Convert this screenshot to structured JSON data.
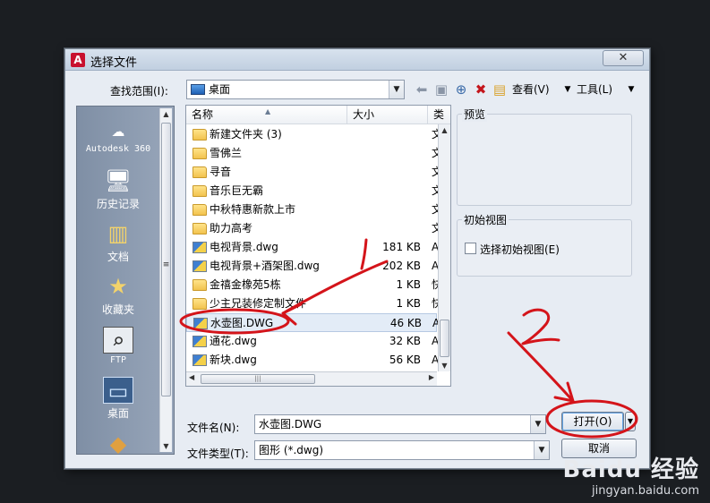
{
  "dialog": {
    "title": "选择文件",
    "app_icon_glyph": "A",
    "close_glyph": "✕"
  },
  "lookin": {
    "label": "查找范围(I):",
    "value": "桌面"
  },
  "toolbar": {
    "view_label": "查看(V)",
    "tools_label": "工具(L)",
    "icons": [
      "back-icon",
      "up-folder-icon",
      "search-web-icon",
      "delete-icon",
      "new-folder-icon",
      "view-dropdown-icon",
      "tools-dropdown-icon"
    ]
  },
  "places": {
    "items": [
      {
        "label": "Autodesk 360",
        "icon": "cloud-icon"
      },
      {
        "label": "历史记录",
        "icon": "history-icon"
      },
      {
        "label": "文档",
        "icon": "documents-icon"
      },
      {
        "label": "收藏夹",
        "icon": "favorites-icon"
      },
      {
        "label": "FTP",
        "icon": "ftp-icon"
      },
      {
        "label": "桌面",
        "icon": "desktop-icon"
      }
    ],
    "selected": "桌面"
  },
  "file_list": {
    "columns": [
      "名称",
      "大小",
      "类"
    ],
    "rows": [
      {
        "name": "新建文件夹 (3)",
        "size": "",
        "type": "文",
        "kind": "folder"
      },
      {
        "name": "雪佛兰",
        "size": "",
        "type": "文",
        "kind": "folder"
      },
      {
        "name": "寻音",
        "size": "",
        "type": "文",
        "kind": "folder"
      },
      {
        "name": "音乐巨无霸",
        "size": "",
        "type": "文",
        "kind": "folder"
      },
      {
        "name": "中秋特惠新款上市",
        "size": "",
        "type": "文",
        "kind": "folder"
      },
      {
        "name": "助力高考",
        "size": "",
        "type": "文",
        "kind": "folder"
      },
      {
        "name": "电视背景.dwg",
        "size": "181 KB",
        "type": "A",
        "kind": "dwg"
      },
      {
        "name": "电视背景+酒架图.dwg",
        "size": "202 KB",
        "type": "A",
        "kind": "dwg"
      },
      {
        "name": "金禧金橡苑5栋",
        "size": "1 KB",
        "type": "快",
        "kind": "folder"
      },
      {
        "name": "少主兄装修定制文件",
        "size": "1 KB",
        "type": "快",
        "kind": "folder"
      },
      {
        "name": "水壶图.DWG",
        "size": "46 KB",
        "type": "A",
        "kind": "dwg"
      },
      {
        "name": "通花.dwg",
        "size": "32 KB",
        "type": "A",
        "kind": "dwg"
      },
      {
        "name": "新块.dwg",
        "size": "56 KB",
        "type": "A",
        "kind": "dwg"
      }
    ],
    "selected_row": "水壶图.DWG"
  },
  "preview": {
    "label": "预览"
  },
  "initial_view": {
    "group_label": "初始视图",
    "checkbox_label": "选择初始视图(E)",
    "checked": false
  },
  "filename": {
    "label": "文件名(N):",
    "value": "水壶图.DWG"
  },
  "filetype": {
    "label": "文件类型(T):",
    "value": "图形 (*.dwg)"
  },
  "buttons": {
    "open": "打开(O)",
    "cancel": "取消"
  },
  "annotations": {
    "mark1": "1",
    "mark2": "2",
    "color": "#d4141a"
  },
  "watermark": {
    "logo": "Baidu 经验",
    "url": "jingyan.baidu.com"
  }
}
